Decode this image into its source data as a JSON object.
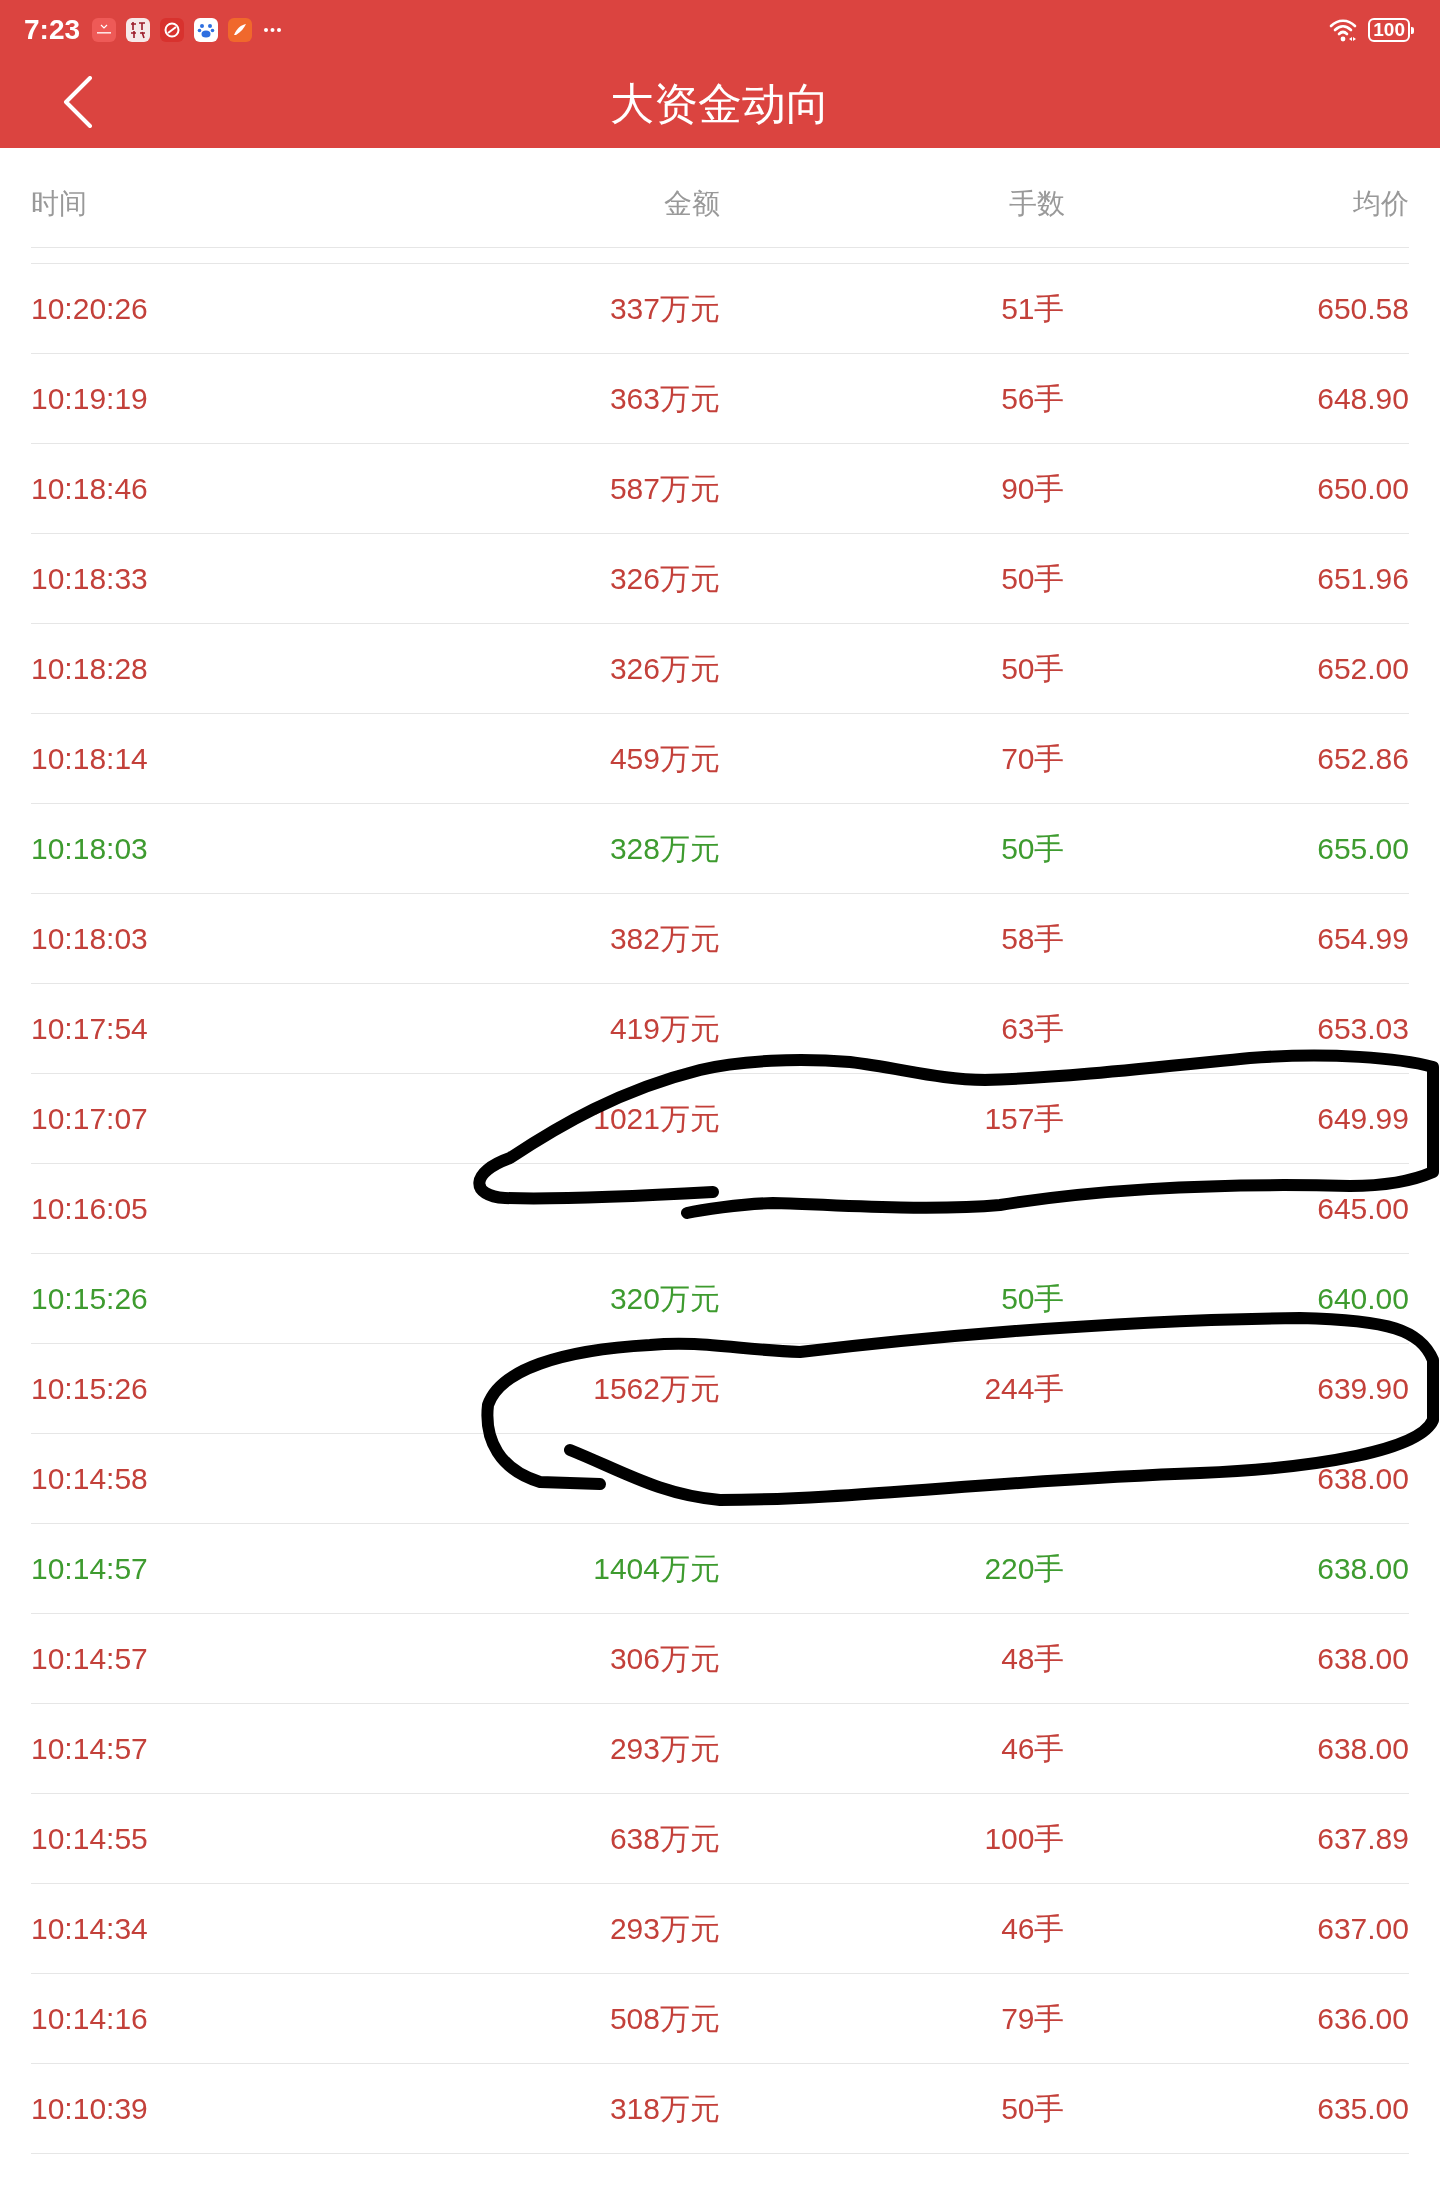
{
  "status_bar": {
    "time": "7:23",
    "battery": "100"
  },
  "nav_bar": {
    "title": "大资金动向"
  },
  "table": {
    "columns": [
      "时间",
      "金额",
      "手数",
      "均价"
    ],
    "rows": [
      {
        "time": "10:20:26",
        "amount": "337万元",
        "lots": "51手",
        "price": "650.58",
        "color": "#c3403a"
      },
      {
        "time": "10:19:19",
        "amount": "363万元",
        "lots": "56手",
        "price": "648.90",
        "color": "#c3403a"
      },
      {
        "time": "10:18:46",
        "amount": "587万元",
        "lots": "90手",
        "price": "650.00",
        "color": "#c3403a"
      },
      {
        "time": "10:18:33",
        "amount": "326万元",
        "lots": "50手",
        "price": "651.96",
        "color": "#c3403a"
      },
      {
        "time": "10:18:28",
        "amount": "326万元",
        "lots": "50手",
        "price": "652.00",
        "color": "#c3403a"
      },
      {
        "time": "10:18:14",
        "amount": "459万元",
        "lots": "70手",
        "price": "652.86",
        "color": "#c3403a"
      },
      {
        "time": "10:18:03",
        "amount": "328万元",
        "lots": "50手",
        "price": "655.00",
        "color": "#3e9b2f"
      },
      {
        "time": "10:18:03",
        "amount": "382万元",
        "lots": "58手",
        "price": "654.99",
        "color": "#c3403a"
      },
      {
        "time": "10:17:54",
        "amount": "419万元",
        "lots": "63手",
        "price": "653.03",
        "color": "#c3403a"
      },
      {
        "time": "10:17:07",
        "amount": "1021万元",
        "lots": "157手",
        "price": "649.99",
        "color": "#c3403a"
      },
      {
        "time": "10:16:05",
        "price": "645.00",
        "color": "#c3403a"
      },
      {
        "time": "10:15:26",
        "amount": "320万元",
        "lots": "50手",
        "price": "640.00",
        "color": "#3e9b2f"
      },
      {
        "time": "10:15:26",
        "amount": "1562万元",
        "lots": "244手",
        "price": "639.90",
        "color": "#c3403a"
      },
      {
        "time": "10:14:58",
        "price": "638.00",
        "color": "#c3403a"
      },
      {
        "time": "10:14:57",
        "amount": "1404万元",
        "lots": "220手",
        "price": "638.00",
        "color": "#3e9b2f"
      },
      {
        "time": "10:14:57",
        "amount": "306万元",
        "lots": "48手",
        "price": "638.00",
        "color": "#c3403a"
      },
      {
        "time": "10:14:57",
        "amount": "293万元",
        "lots": "46手",
        "price": "638.00",
        "color": "#c3403a"
      },
      {
        "time": "10:14:55",
        "amount": "638万元",
        "lots": "100手",
        "price": "637.89",
        "color": "#c3403a"
      },
      {
        "time": "10:14:34",
        "amount": "293万元",
        "lots": "46手",
        "price": "637.00",
        "color": "#c3403a"
      },
      {
        "time": "10:14:16",
        "amount": "508万元",
        "lots": "79手",
        "price": "636.00",
        "color": "#c3403a"
      },
      {
        "time": "10:10:39",
        "amount": "318万元",
        "lots": "50手",
        "price": "635.00",
        "color": "#c3403a"
      }
    ]
  }
}
